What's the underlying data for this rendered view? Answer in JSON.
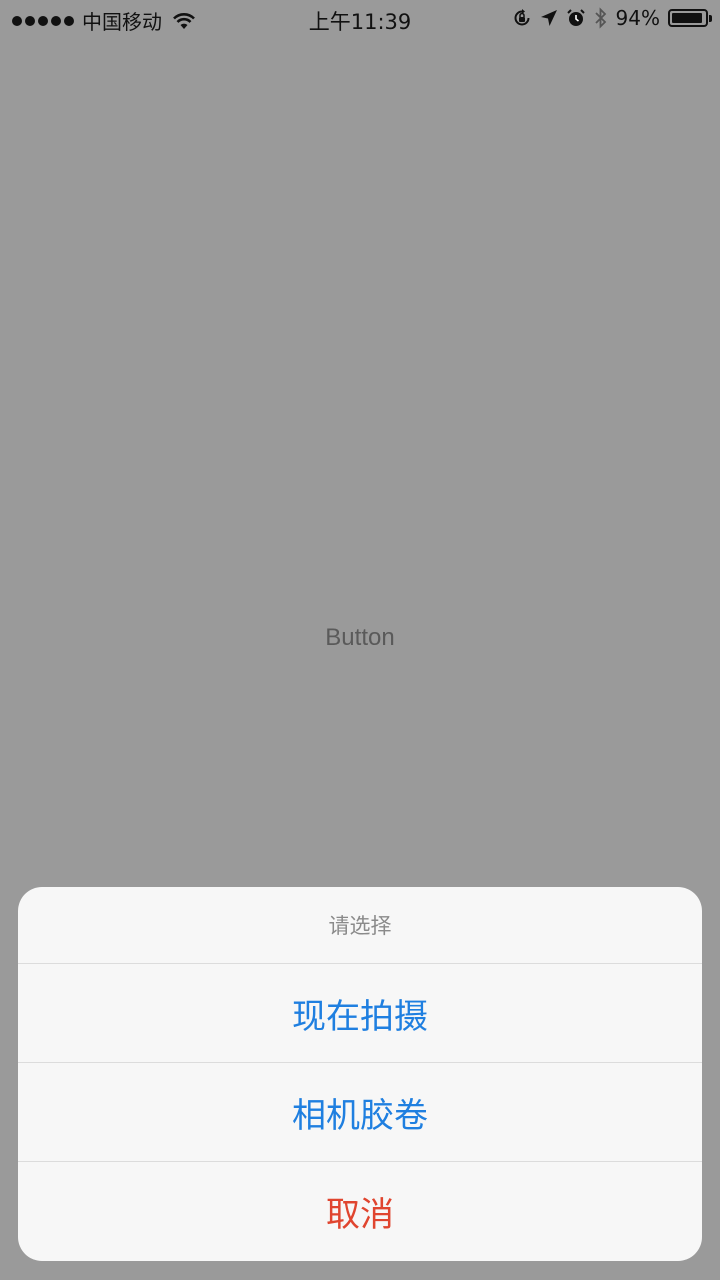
{
  "status_bar": {
    "carrier": "中国移动",
    "time": "上午11:39",
    "battery_percent": "94%",
    "battery_level": 0.94,
    "icons": [
      "signal-dots",
      "wifi-icon",
      "orientation-lock-icon",
      "location-arrow-icon",
      "alarm-icon",
      "bluetooth-icon",
      "battery-icon"
    ]
  },
  "main": {
    "button_label": "Button"
  },
  "action_sheet": {
    "title": "请选择",
    "options": [
      {
        "label": "现在拍摄"
      },
      {
        "label": "相机胶卷"
      }
    ],
    "cancel_label": "取消",
    "colors": {
      "option": "#1f7fe0",
      "cancel": "#e0452f"
    }
  }
}
